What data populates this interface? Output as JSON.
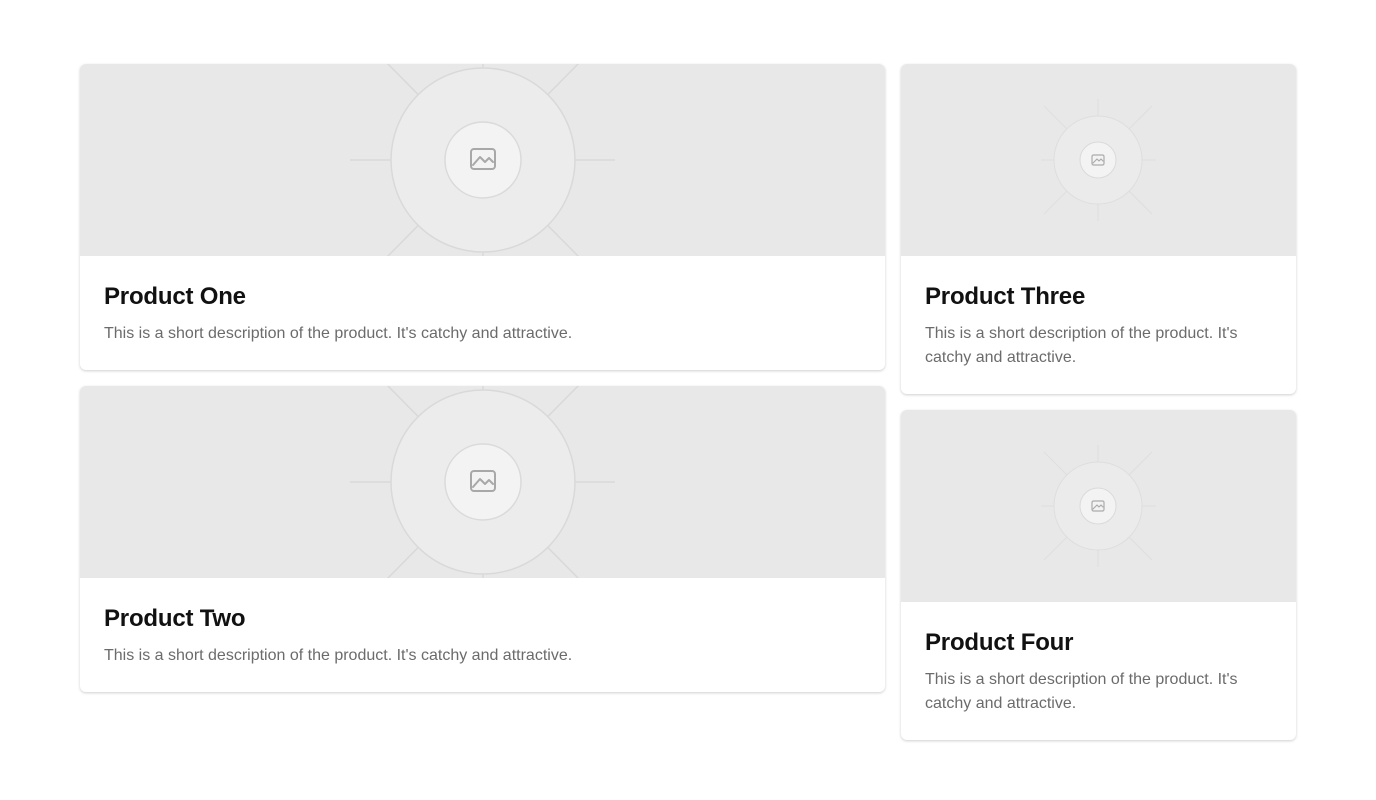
{
  "products": [
    {
      "title": "Product One",
      "description": "This is a short description of the product. It's catchy and attractive.",
      "image_icon": "image-placeholder-icon"
    },
    {
      "title": "Product Two",
      "description": "This is a short description of the product. It's catchy and attractive.",
      "image_icon": "image-placeholder-icon"
    },
    {
      "title": "Product Three",
      "description": "This is a short description of the product. It's catchy and attractive.",
      "image_icon": "image-placeholder-icon"
    },
    {
      "title": "Product Four",
      "description": "This is a short description of the product. It's catchy and attractive.",
      "image_icon": "image-placeholder-icon"
    }
  ],
  "colors": {
    "page_background": "#ffffff",
    "image_background": "#e8e8e8",
    "title_text": "#111111",
    "description_text": "#6b6b6b"
  }
}
